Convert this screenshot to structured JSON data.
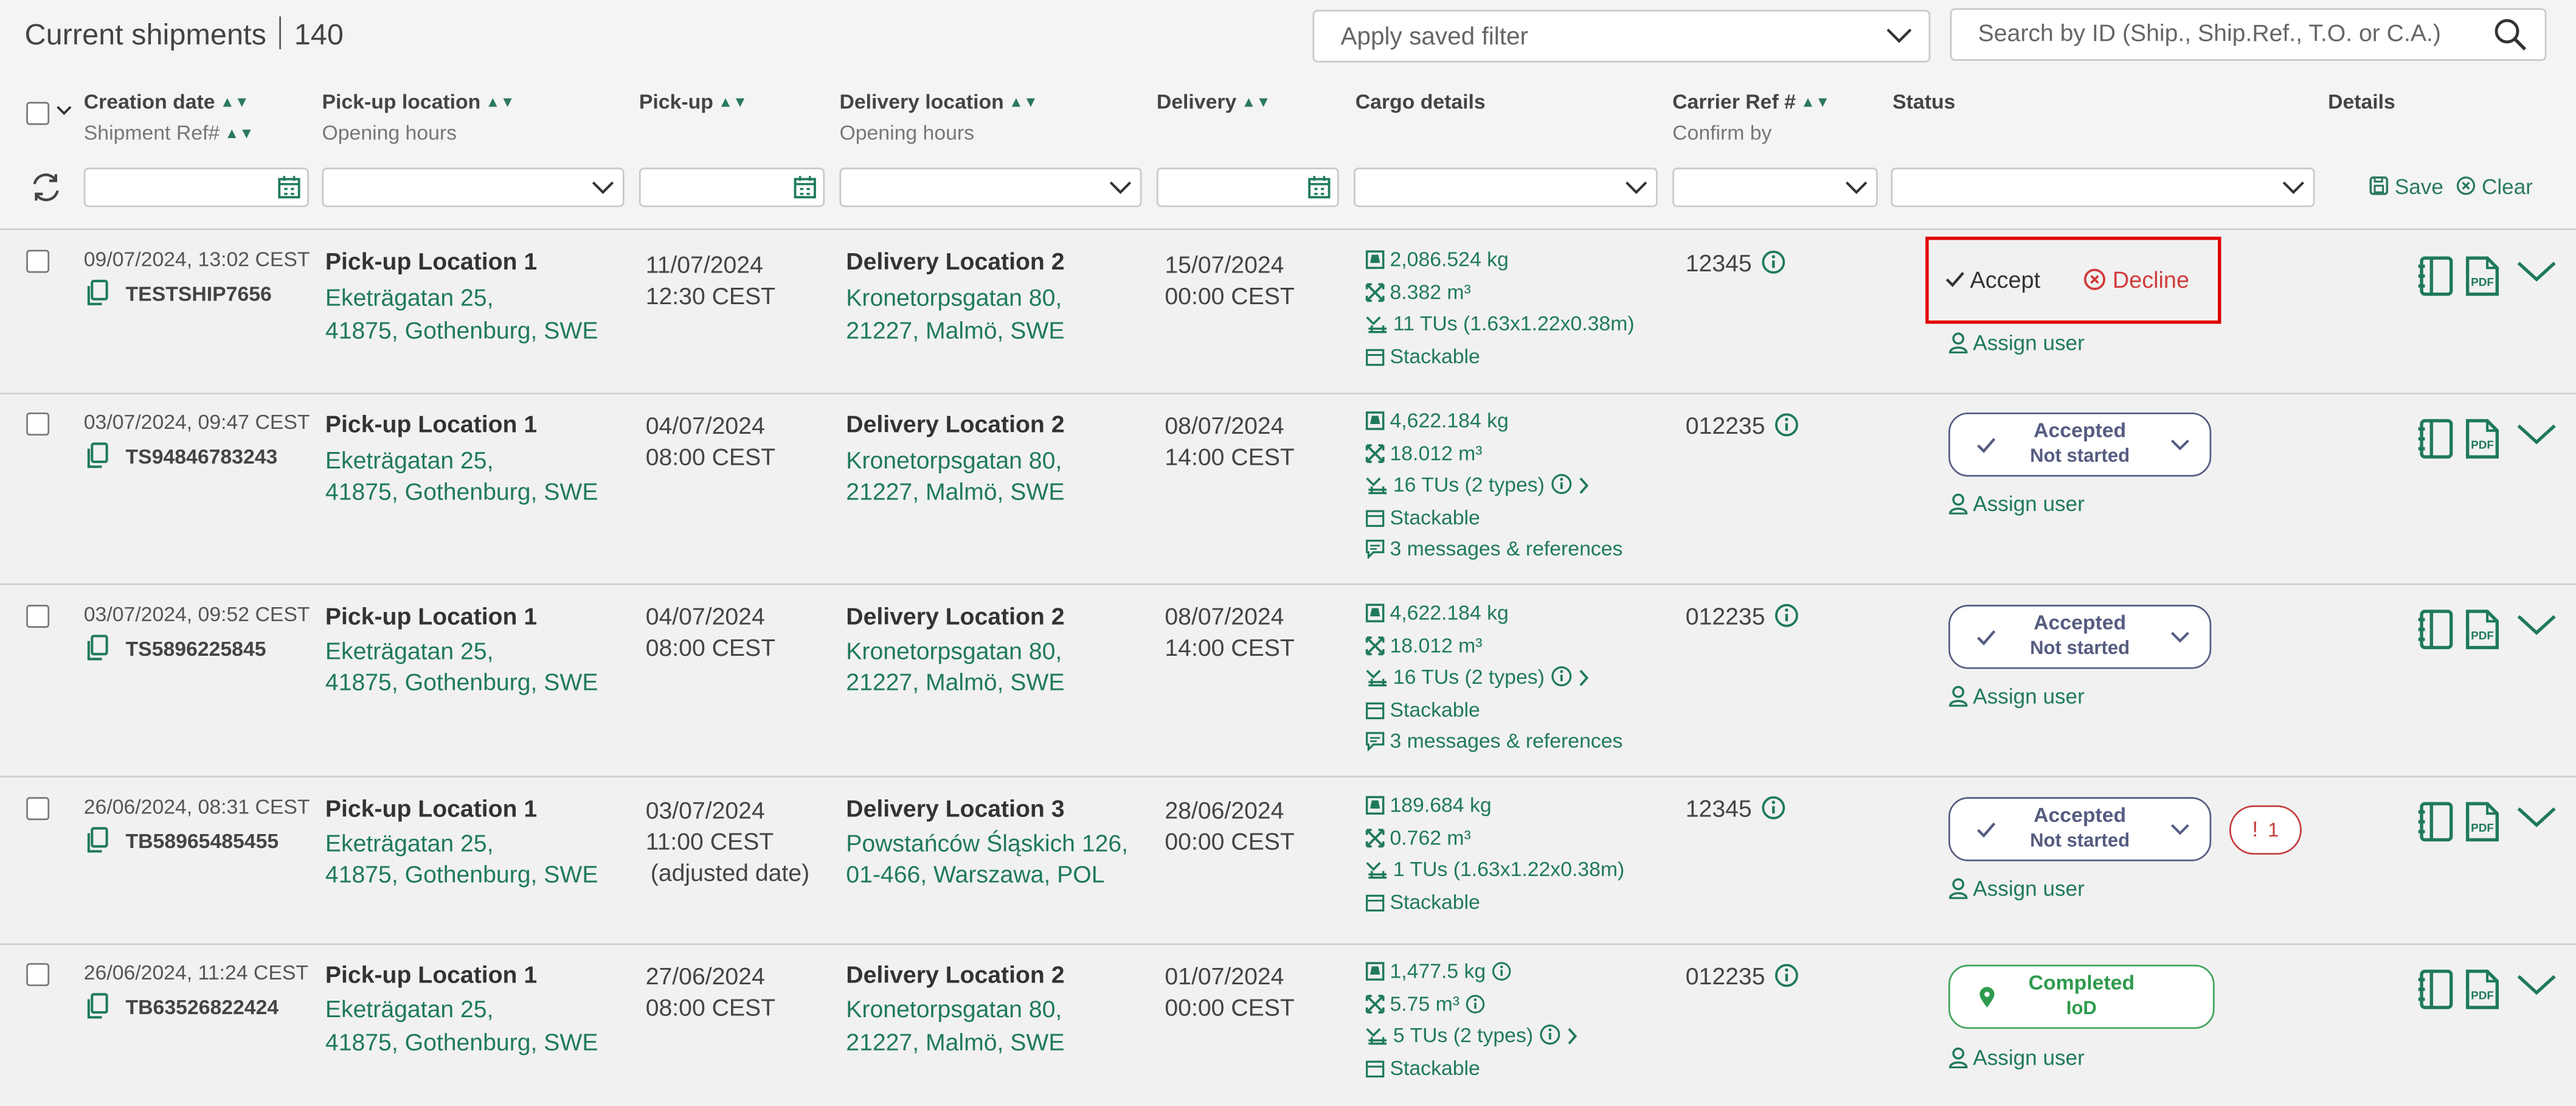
{
  "header": {
    "title": "Current shipments",
    "count": "140",
    "saved_filter_placeholder": "Apply saved filter",
    "search_placeholder": "Search by ID (Ship., Ship.Ref., T.O. or C.A.)"
  },
  "columns": {
    "creation_date": "Creation date",
    "shipment_ref": "Shipment Ref#",
    "pickup_location": "Pick-up location",
    "pickup_opening": "Opening hours",
    "pickup": "Pick-up",
    "delivery_location": "Delivery location",
    "delivery_opening": "Opening hours",
    "delivery": "Delivery",
    "cargo_details": "Cargo details",
    "carrier_ref": "Carrier Ref #",
    "confirm_by": "Confirm by",
    "status": "Status",
    "details": "Details"
  },
  "filters": {
    "save_label": "Save",
    "clear_label": "Clear"
  },
  "actions": {
    "accept": "Accept",
    "decline": "Decline",
    "assign_user": "Assign user"
  },
  "rows": [
    {
      "created": "09/07/2024, 13:02 CEST",
      "shipment_ref": "TESTSHIP7656",
      "pickup_name": "Pick-up Location 1",
      "pickup_addr1": "Eketrägatan 25,",
      "pickup_addr2": "41875, Gothenburg, SWE",
      "pickup_date": "11/07/2024",
      "pickup_time": "12:30 CEST",
      "delivery_name": "Delivery Location 2",
      "delivery_addr1": "Kronetorpsgatan 80,",
      "delivery_addr2": "21227, Malmö, SWE",
      "delivery_date": "15/07/2024",
      "delivery_time": "00:00 CEST",
      "weight": "2,086.524 kg",
      "volume": "8.382 m³",
      "tus": "11 TUs (1.63x1.22x0.38m)",
      "stackable": "Stackable",
      "carrier_ref": "12345"
    },
    {
      "created": "03/07/2024, 09:47 CEST",
      "shipment_ref": "TS94846783243",
      "pickup_name": "Pick-up Location 1",
      "pickup_addr1": "Eketrägatan 25,",
      "pickup_addr2": "41875, Gothenburg, SWE",
      "pickup_date": "04/07/2024",
      "pickup_time": "08:00 CEST",
      "delivery_name": "Delivery Location 2",
      "delivery_addr1": "Kronetorpsgatan 80,",
      "delivery_addr2": "21227, Malmö, SWE",
      "delivery_date": "08/07/2024",
      "delivery_time": "14:00 CEST",
      "weight": "4,622.184 kg",
      "volume": "18.012 m³",
      "tus": "16 TUs (2 types)",
      "stackable": "Stackable",
      "messages": "3 messages & references",
      "carrier_ref": "012235",
      "status_line1": "Accepted",
      "status_line2": "Not started"
    },
    {
      "created": "03/07/2024, 09:52 CEST",
      "shipment_ref": "TS5896225845",
      "pickup_name": "Pick-up Location 1",
      "pickup_addr1": "Eketrägatan 25,",
      "pickup_addr2": "41875, Gothenburg, SWE",
      "pickup_date": "04/07/2024",
      "pickup_time": "08:00 CEST",
      "delivery_name": "Delivery Location 2",
      "delivery_addr1": "Kronetorpsgatan 80,",
      "delivery_addr2": "21227, Malmö, SWE",
      "delivery_date": "08/07/2024",
      "delivery_time": "14:00 CEST",
      "weight": "4,622.184 kg",
      "volume": "18.012 m³",
      "tus": "16 TUs (2 types)",
      "stackable": "Stackable",
      "messages": "3 messages & references",
      "carrier_ref": "012235",
      "status_line1": "Accepted",
      "status_line2": "Not started"
    },
    {
      "created": "26/06/2024, 08:31 CEST",
      "shipment_ref": "TB58965485455",
      "pickup_name": "Pick-up Location 1",
      "pickup_addr1": "Eketrägatan 25,",
      "pickup_addr2": "41875, Gothenburg, SWE",
      "pickup_date": "03/07/2024",
      "pickup_time": "11:00 CEST",
      "pickup_note": "(adjusted date)",
      "delivery_name": "Delivery Location 3",
      "delivery_addr1": "Powstańców Śląskich 126,",
      "delivery_addr2": "01-466, Warszawa, POL",
      "delivery_date": "28/06/2024",
      "delivery_time": "00:00 CEST",
      "weight": "189.684 kg",
      "volume": "0.762 m³",
      "tus": "1 TUs (1.63x1.22x0.38m)",
      "stackable": "Stackable",
      "carrier_ref": "12345",
      "status_line1": "Accepted",
      "status_line2": "Not started",
      "warning_count": "1"
    },
    {
      "created": "26/06/2024, 11:24 CEST",
      "shipment_ref": "TB63526822424",
      "pickup_name": "Pick-up Location 1",
      "pickup_addr1": "Eketrägatan 25,",
      "pickup_addr2": "41875, Gothenburg, SWE",
      "pickup_date": "27/06/2024",
      "pickup_time": "08:00 CEST",
      "delivery_name": "Delivery Location 2",
      "delivery_addr1": "Kronetorpsgatan 80,",
      "delivery_addr2": "21227, Malmö, SWE",
      "delivery_date": "01/07/2024",
      "delivery_time": "00:00 CEST",
      "weight": "1,477.5 kg",
      "volume": "5.75 m³",
      "tus": "5 TUs (2 types)",
      "stackable": "Stackable",
      "carrier_ref": "012235",
      "status_line1": "Completed",
      "status_line2": "IoD"
    }
  ],
  "colors": {
    "brand_green": "#1f7a5b",
    "status_blue": "#555c80",
    "complete_green": "#2f9a4d",
    "decline_red": "#d23b3b",
    "highlight_red": "#e00000"
  },
  "icons": [
    "search-icon",
    "chevron-down-icon",
    "sort-icon",
    "calendar-icon",
    "refresh-icon",
    "save-icon",
    "clear-icon",
    "copy-icon",
    "weight-icon",
    "volume-icon",
    "pallet-icon",
    "stackable-icon",
    "message-icon",
    "info-icon",
    "check-icon",
    "decline-icon",
    "user-icon",
    "document-icon",
    "pdf-icon",
    "location-pin-icon",
    "warning-icon"
  ]
}
